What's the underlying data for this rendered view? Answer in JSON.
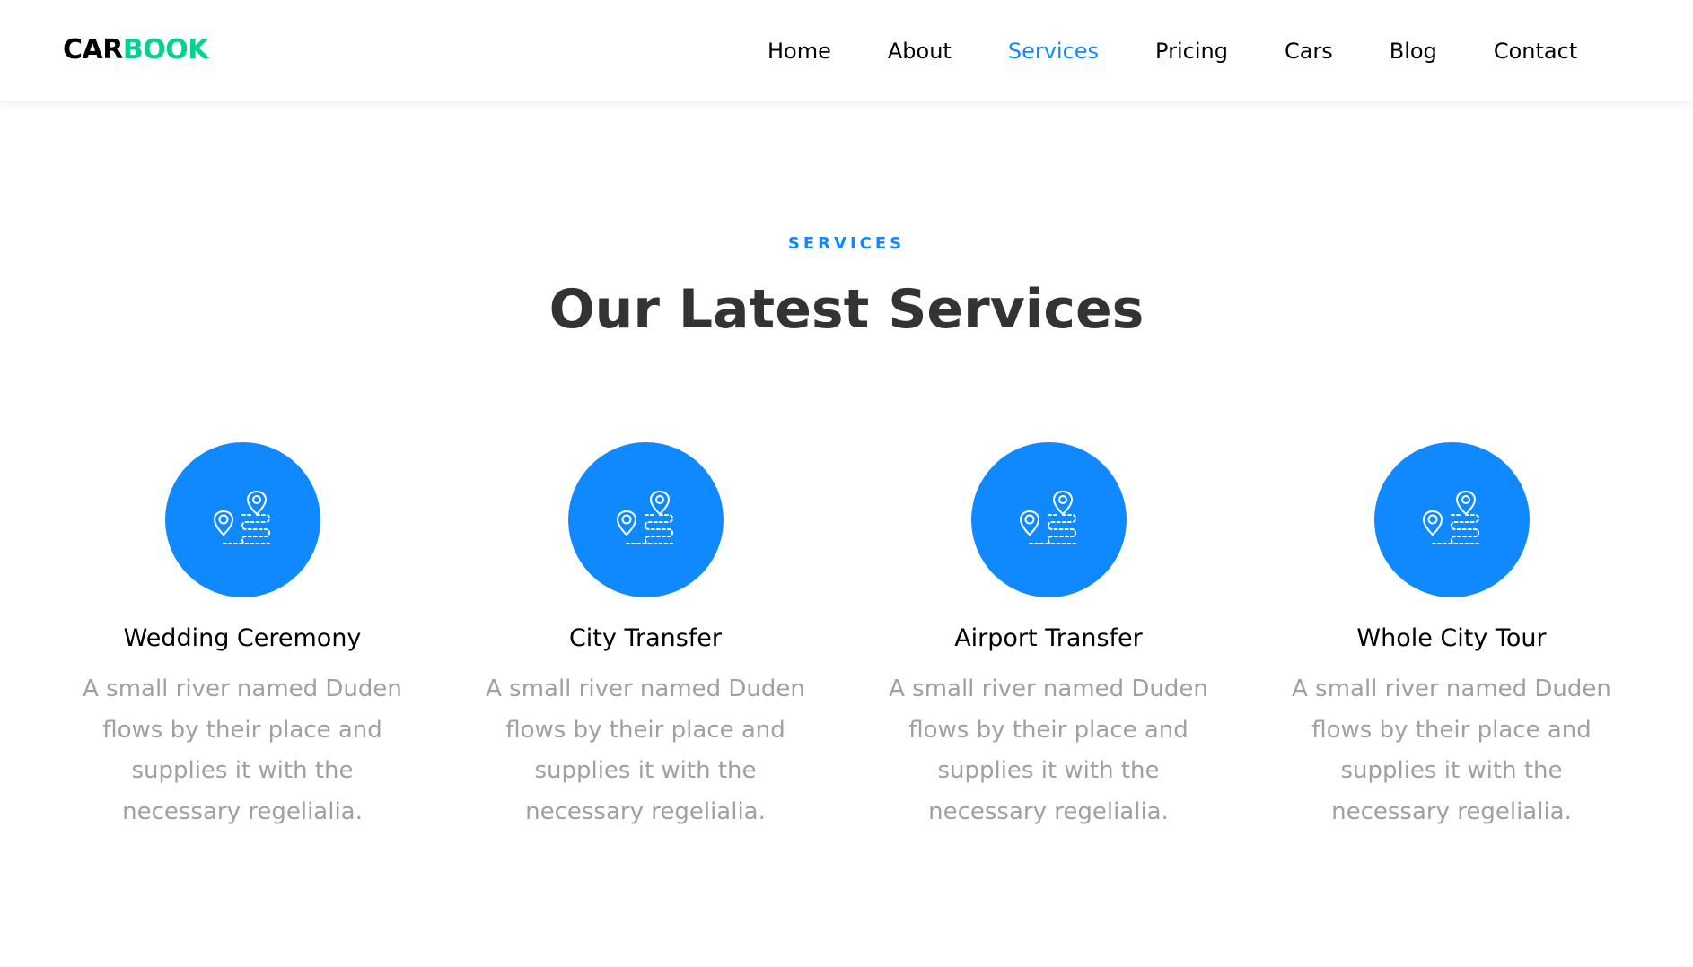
{
  "brand": {
    "part1": "CAR",
    "part2": "BOOK"
  },
  "nav": {
    "items": [
      {
        "label": "Home",
        "active": false
      },
      {
        "label": "About",
        "active": false
      },
      {
        "label": "Services",
        "active": true
      },
      {
        "label": "Pricing",
        "active": false
      },
      {
        "label": "Cars",
        "active": false
      },
      {
        "label": "Blog",
        "active": false
      },
      {
        "label": "Contact",
        "active": false
      }
    ]
  },
  "section": {
    "subheading": "SERVICES",
    "title": "Our Latest Services"
  },
  "services": [
    {
      "title": "Wedding Ceremony",
      "text": "A small river named Duden flows by their place and supplies it with the necessary regelialia.",
      "icon": "route-map-icon"
    },
    {
      "title": "City Transfer",
      "text": "A small river named Duden flows by their place and supplies it with the necessary regelialia.",
      "icon": "route-map-icon"
    },
    {
      "title": "Airport Transfer",
      "text": "A small river named Duden flows by their place and supplies it with the necessary regelialia.",
      "icon": "route-map-icon"
    },
    {
      "title": "Whole City Tour",
      "text": "A small river named Duden flows by their place and supplies it with the necessary regelialia.",
      "icon": "route-map-icon"
    }
  ],
  "colors": {
    "accent": "#1089ff",
    "brand_green": "#01d28e",
    "text_dark": "#333333",
    "text_muted": "#a0a0a0"
  }
}
